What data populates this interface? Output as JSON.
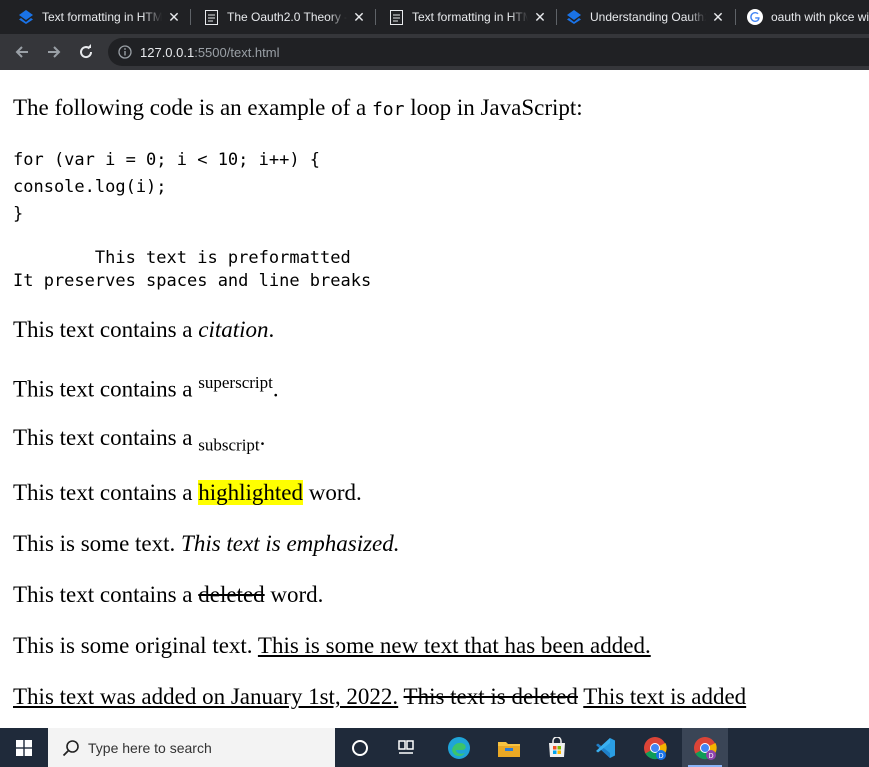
{
  "browser": {
    "tabs": [
      {
        "title": "Text formatting in HTM",
        "icon": "stack-icon"
      },
      {
        "title": "The Oauth2.0 Theory -",
        "icon": "document-icon"
      },
      {
        "title": "Text formatting in HTM",
        "icon": "document-icon"
      },
      {
        "title": "Understanding Oauth2.",
        "icon": "stack-icon"
      },
      {
        "title": "oauth with pkce wi",
        "icon": "google-icon"
      }
    ],
    "close_glyph": "✕",
    "url_host": "127.0.0.1",
    "url_path": ":5500/text.html"
  },
  "content": {
    "intro_before": "The following code is an example of a ",
    "intro_code": "for",
    "intro_after": " loop in JavaScript:",
    "code_lines": [
      "for (var i = 0; i < 10; i++) {",
      "console.log(i);",
      "}"
    ],
    "pre_lines": [
      "        This text is preformatted",
      "It preserves spaces and line breaks"
    ],
    "citation_before": "This text contains a ",
    "citation_word": "citation",
    "citation_after": ".",
    "sup_before": "This text contains a ",
    "sup_word": "superscript",
    "sup_after": ".",
    "sub_before": "This text contains a ",
    "sub_word": "subscript",
    "sub_after": ".",
    "mark_before": "This text contains a ",
    "mark_word": "highlighted",
    "mark_after": " word.",
    "em_before": "This is some text. ",
    "em_text": "This text is emphasized.",
    "del_before": "This text contains a ",
    "del_word": "deleted",
    "del_after": " word.",
    "ins_before": "This is some original text. ",
    "ins_text": "This is some new text that has been added.",
    "last_ins1": "This text was added on January 1st, 2022.",
    "last_del": "This text is deleted",
    "last_ins2": "This text is added"
  },
  "taskbar": {
    "search_placeholder": "Type here to search",
    "items": [
      "cortana-icon",
      "task-view-icon",
      "edge-icon",
      "file-explorer-icon",
      "store-icon",
      "vscode-icon",
      "chrome-icon",
      "chrome-icon"
    ]
  }
}
